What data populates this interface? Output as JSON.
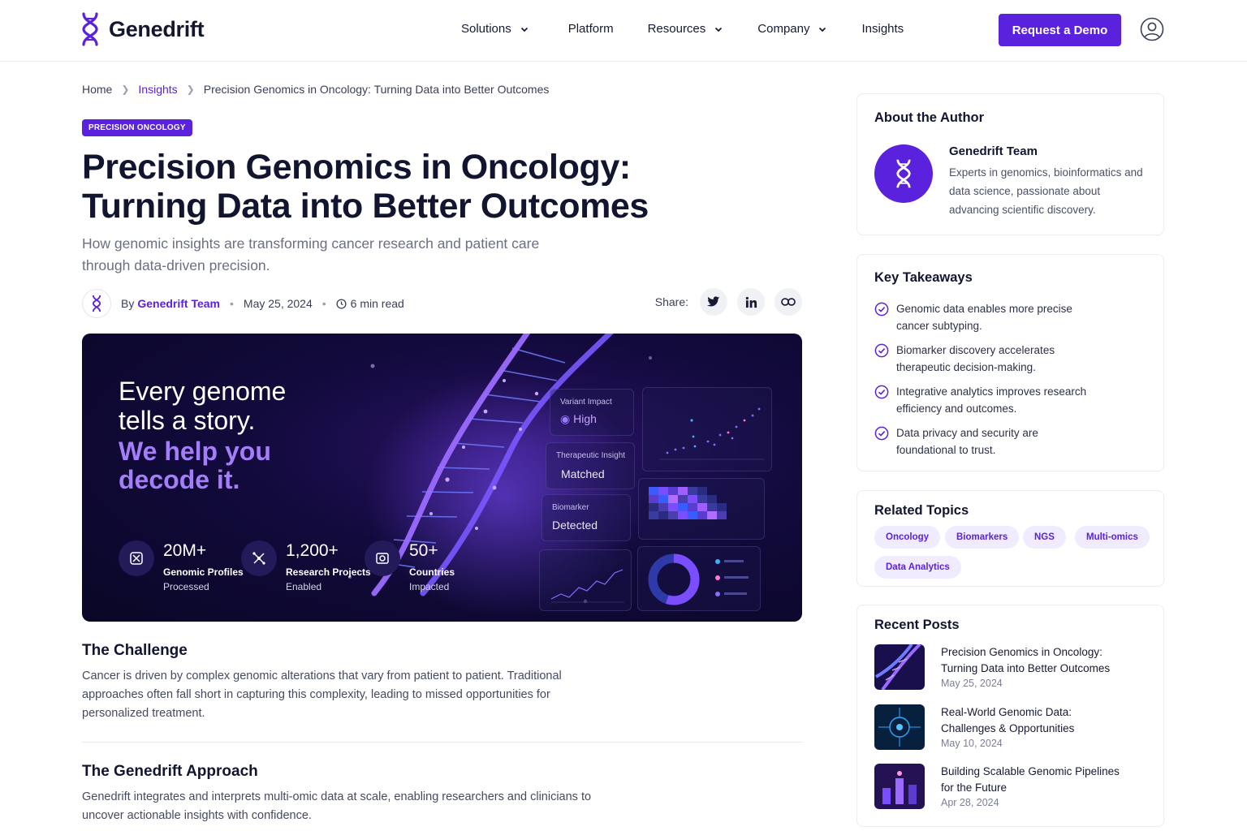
{
  "brand": {
    "name": "Genedrift",
    "accent": "#5a22dc"
  },
  "nav": {
    "items": [
      {
        "label": "Solutions",
        "dropdown": true
      },
      {
        "label": "Platform",
        "dropdown": false
      },
      {
        "label": "Resources",
        "dropdown": true
      },
      {
        "label": "Company",
        "dropdown": true
      },
      {
        "label": "Insights",
        "dropdown": false
      }
    ],
    "cta": "Request a Demo",
    "user_icon": "user-circle-icon"
  },
  "breadcrumb": {
    "home": "Home",
    "section": "Insights",
    "current": "Precision Genomics in Oncology: Turning Data into Better Outcomes"
  },
  "article": {
    "category": "PRECISION ONCOLOGY",
    "title_line1": "Precision Genomics in Oncology:",
    "title_line2": "Turning Data into Better Outcomes",
    "subtitle_line1": "How genomic insights are transforming cancer research and patient care",
    "subtitle_line2": "through data-driven precision.",
    "by": "By",
    "author": "Genedrift Team",
    "date": "May 25, 2024",
    "read_time": "6 min read",
    "share_label": "Share:",
    "share_icons": [
      "twitter-icon",
      "linkedin-icon",
      "link-icon"
    ]
  },
  "hero": {
    "line1": "Every genome",
    "line2": "tells a story.",
    "line3": "We help you",
    "line4": "decode it.",
    "stats": [
      {
        "value": "20M+",
        "label1": "Genomic Profiles",
        "label2": "Processed"
      },
      {
        "value": "1,200+",
        "label1": "Research Projects",
        "label2": "Enabled"
      },
      {
        "value": "50+",
        "label1": "Countries",
        "label2": "Impacted"
      }
    ],
    "panels": [
      {
        "label": "Variant Impact",
        "value": "High"
      },
      {
        "label": "Therapeutic Insight",
        "value": "Matched"
      },
      {
        "label": "Biomarker",
        "value": "Detected"
      }
    ]
  },
  "sections": [
    {
      "heading": "The Challenge",
      "body": "Cancer is driven by complex genomic alterations that vary from patient to patient. Traditional approaches often fall short in capturing this complexity, leading to missed opportunities for personalized treatment."
    },
    {
      "heading": "The Genedrift Approach",
      "body": "Genedrift integrates and interprets multi-omic data at scale, enabling researchers and clinicians to uncover actionable insights with confidence."
    }
  ],
  "sidebar": {
    "about": {
      "heading": "About the Author",
      "name": "Genedrift Team",
      "bio": "Experts in genomics, bioinformatics and data science, passionate about advancing scientific discovery."
    },
    "takeaways": {
      "heading": "Key Takeaways",
      "items": [
        "Genomic data enables more precise cancer subtyping.",
        "Biomarker discovery accelerates therapeutic decision-making.",
        "Integrative analytics improves research efficiency and outcomes.",
        "Data privacy and security are foundational to trust."
      ]
    },
    "topics": {
      "heading": "Related Topics",
      "items": [
        "Oncology",
        "Biomarkers",
        "NGS",
        "Multi-omics",
        "Data Analytics"
      ]
    },
    "recent": {
      "heading": "Recent Posts",
      "items": [
        {
          "title": "Precision Genomics in Oncology: Turning Data into Better Outcomes",
          "date": "May 25, 2024"
        },
        {
          "title": "Real-World Genomic Data: Challenges & Opportunities",
          "date": "May 10, 2024"
        },
        {
          "title": "Building Scalable Genomic Pipelines for the Future",
          "date": "Apr 28, 2024"
        }
      ]
    }
  }
}
